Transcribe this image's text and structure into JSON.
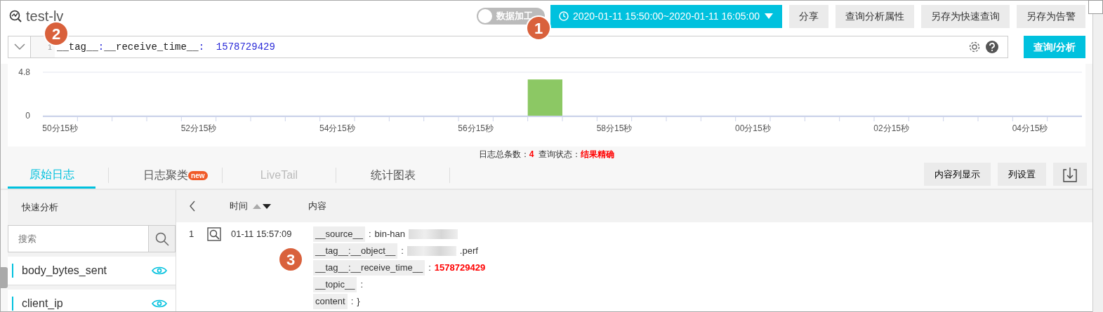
{
  "header": {
    "title": "test-lv",
    "toggle": {
      "label": "数据加工",
      "on": false
    },
    "time_range": "2020-01-11 15:50:00~2020-01-11 16:05:00",
    "buttons": [
      "分享",
      "查询分析属性",
      "另存为快速查询",
      "另存为告警"
    ]
  },
  "query": {
    "line_number": "1",
    "tokens": [
      {
        "text": "__tag__",
        "kind": "key"
      },
      {
        "text": ":",
        "kind": "punct"
      },
      {
        "text": "__receive_time__",
        "kind": "key"
      },
      {
        "text": ":",
        "kind": "punct"
      },
      {
        "text": "  1578729429",
        "kind": "number"
      }
    ],
    "submit": "查询/分析"
  },
  "histogram": {
    "chart_data": {
      "type": "bar",
      "categories": [
        "50分15秒",
        null,
        null,
        null,
        "52分15秒",
        null,
        null,
        null,
        "54分15秒",
        null,
        null,
        null,
        "56分15秒",
        null,
        null,
        null,
        "58分15秒",
        null,
        null,
        null,
        "00分15秒",
        null,
        null,
        null,
        "02分15秒",
        null,
        null,
        null,
        "04分15秒",
        null
      ],
      "ylim": [
        0,
        4.8
      ],
      "yticks": [
        0,
        4.8
      ],
      "series": [
        {
          "color": "#8cc864",
          "values": [
            0,
            0,
            0,
            0,
            0,
            0,
            0,
            0,
            0,
            0,
            0,
            0,
            0,
            0,
            4,
            0,
            0,
            0,
            0,
            0,
            0,
            0,
            0,
            0,
            0,
            0,
            0,
            0,
            0,
            0
          ]
        }
      ]
    }
  },
  "summary": {
    "count_label": "日志总条数：",
    "count": "4",
    "status_label": "查询状态：",
    "status": "结果精确"
  },
  "tabs": [
    {
      "label": "原始日志",
      "selected": true,
      "disabled": false
    },
    {
      "label": "日志聚类",
      "selected": false,
      "disabled": false,
      "badge": "new"
    },
    {
      "label": "LiveTail",
      "selected": false,
      "disabled": true
    },
    {
      "label": "统计图表",
      "selected": false,
      "disabled": false
    }
  ],
  "tab_actions": [
    "内容列显示",
    "列设置"
  ],
  "sidebar": {
    "title": "快速分析",
    "search_placeholder": "搜索",
    "fields": [
      "body_bytes_sent",
      "client_ip"
    ]
  },
  "table": {
    "columns": [
      "时间",
      "内容"
    ],
    "rows": [
      {
        "index": "1",
        "time": "01-11 15:57:09",
        "fields": [
          {
            "key": "__source__",
            "separator": ":",
            "value": "bin-han",
            "blurred_suffix": true,
            "highlight": false
          },
          {
            "key": "__tag__:__object__",
            "separator": ":",
            "value": ".perf",
            "blurred_prefix": true,
            "highlight": false
          },
          {
            "key": "__tag__:__receive_time__",
            "separator": ":",
            "value": "1578729429",
            "highlight": true
          },
          {
            "key": "__topic__",
            "separator": ":"
          },
          {
            "key": "content",
            "separator": ":",
            "value": "}",
            "highlight": false
          }
        ]
      }
    ]
  },
  "callouts": [
    "1",
    "2",
    "3"
  ]
}
